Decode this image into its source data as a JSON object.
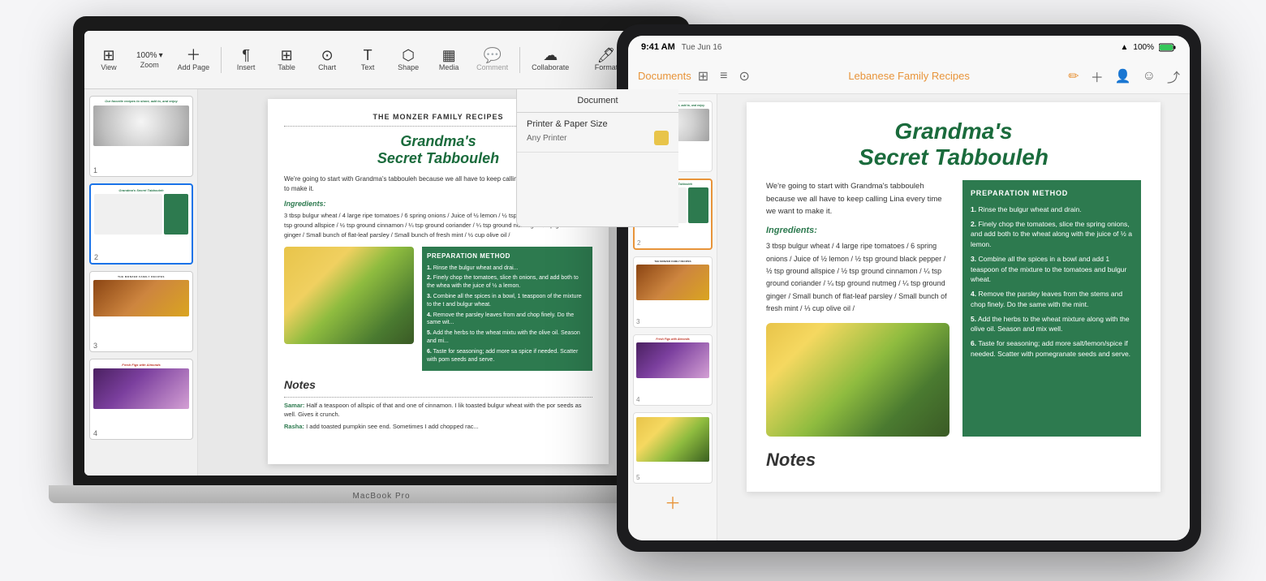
{
  "macbook": {
    "label": "MacBook Pro",
    "toolbar": {
      "zoom": "100%",
      "view_label": "View",
      "zoom_label": "Zoom",
      "add_page_label": "Add Page",
      "insert_label": "Insert",
      "table_label": "Table",
      "chart_label": "Chart",
      "text_label": "Text",
      "shape_label": "Shape",
      "media_label": "Media",
      "comment_label": "Comment",
      "collaborate_label": "Collaborate",
      "format_label": "Format",
      "document_label": "Document"
    },
    "doc_panel": {
      "title": "Document",
      "printer_label": "Printer & Paper Size",
      "printer_value": "Any Printer"
    },
    "page": {
      "header": "THE MONZER FAMILY RECIPES",
      "recipe_title_line1": "Grandma's",
      "recipe_title_line2": "Secret Tabbouleh",
      "intro": "We're going to start with Grandma's tabbouleh because we all have to keep calling Lina every time we want to make it.",
      "ingredients_title": "Ingredients:",
      "ingredients": "3 tbsp bulgur wheat / 4 large ripe tomatoes / 6 spring onions / Juice of ½ lemon / ½ tsp ground black pepper / ½ tsp ground allspice / ½ tsp ground cinnamon / ¼ tsp ground coriander / ¼ tsp ground nutmeg / ¼ tsp ground ginger / Small bunch of flat-leaf parsley / Small bunch of fresh mint / ½ cup olive oil /",
      "prep_title": "PREPARATION METHOD",
      "prep_steps": [
        "Rinse the bulgur wheat and drai...",
        "Finely chop the tomatoes, slice th onions, and add both to the whea with the juice of ½ a lemon.",
        "Combine all the spices in a bowl, 1 teaspoon of the mixture to the t and bulgur wheat.",
        "Remove the parsley leaves from and chop finely. Do the same wit...",
        "Add the herbs to the wheat mixtu with the olive oil. Season and mi...",
        "Taste for seasoning; add more sa spice if needed. Scatter with pom seeds and serve."
      ],
      "notes_title": "Notes",
      "notes": [
        {
          "name": "Samar:",
          "text": "Half a teaspoon of allspic of that and one of cinnamon. I lik toasted bulgur wheat with the por seeds as well. Gives it crunch."
        },
        {
          "name": "Rasha:",
          "text": "I add toasted pumpkin see end. Sometimes I add chopped rac..."
        }
      ]
    },
    "thumbnails": [
      {
        "num": "1",
        "type": "cover"
      },
      {
        "num": "2",
        "type": "tabbouleh",
        "active": true
      },
      {
        "num": "3",
        "type": "spices"
      },
      {
        "num": "4",
        "type": "figs"
      }
    ]
  },
  "ipad": {
    "status_bar": {
      "time": "9:41 AM",
      "date": "Tue Jun 16",
      "wifi": "WiFi",
      "battery": "100%"
    },
    "toolbar": {
      "back_label": "Documents",
      "doc_title": "Lebanese Family Recipes"
    },
    "page": {
      "recipe_title_line1": "Grandma's",
      "recipe_title_line2": "Secret Tabbouleh",
      "intro": "We're going to start with Grandma's tabbouleh because we all have to keep calling Lina every time we want to make it.",
      "ingredients_title": "Ingredients:",
      "ingredients": "3 tbsp bulgur wheat / 4 large ripe tomatoes / 6 spring onions / Juice of ½ lemon / ½ tsp ground black pepper / ½ tsp ground allspice / ½ tsp ground cinnamon / ¼ tsp ground coriander / ¼ tsp ground nutmeg / ¼ tsp ground ginger / Small bunch of flat-leaf parsley / Small bunch of fresh mint / ⅓ cup olive oil /",
      "prep_title": "PREPARATION METHOD",
      "prep_steps": [
        "Rinse the bulgur wheat and drain.",
        "Finely chop the tomatoes, slice the spring onions, and add both to the wheat along with the juice of ½ a lemon.",
        "Combine all the spices in a bowl and add 1 teaspoon of the mixture to the tomatoes and bulgur wheat.",
        "Remove the parsley leaves from the stems and chop finely. Do the same with the mint.",
        "Add the herbs to the wheat mixture along with the olive oil. Season and mix well.",
        "Taste for seasoning; add more salt/lemon/spice if needed. Scatter with pomegranate seeds and serve."
      ],
      "notes_title": "Notes"
    },
    "thumbnails": [
      {
        "num": "1",
        "type": "cover"
      },
      {
        "num": "2",
        "type": "tabbouleh",
        "active": true
      },
      {
        "num": "3",
        "type": "spices"
      },
      {
        "num": "4",
        "type": "figs"
      },
      {
        "num": "5",
        "type": "lemons"
      }
    ]
  }
}
